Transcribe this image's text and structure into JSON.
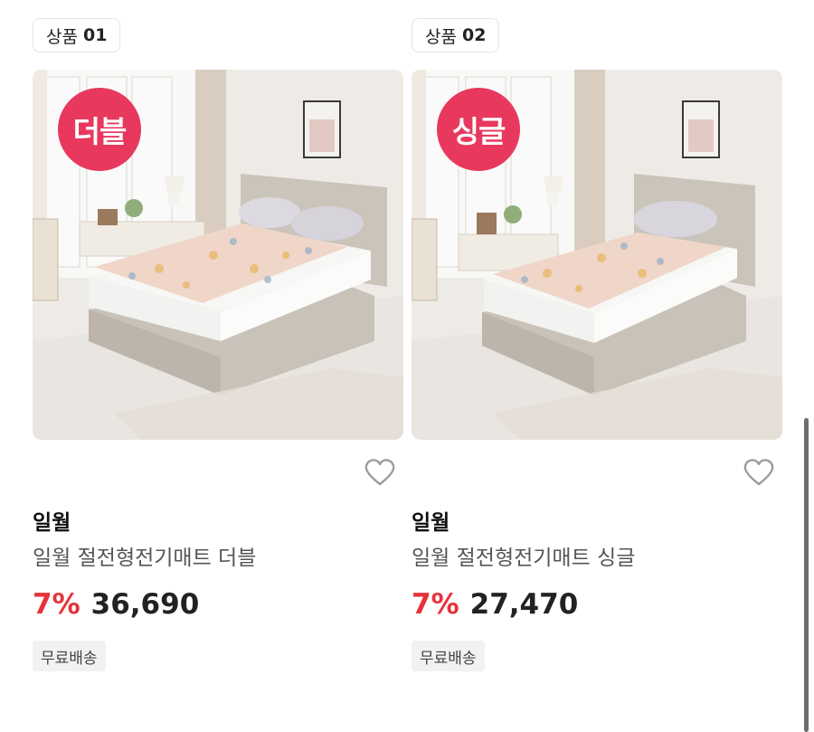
{
  "products": [
    {
      "tag_prefix": "상품",
      "tag_number": "01",
      "badge": "더블",
      "brand": "일월",
      "title": "일월 절전형전기매트 더블",
      "discount": "7%",
      "price": "36,690",
      "shipping": "무료배송",
      "wish_icon": "heart-outline-icon"
    },
    {
      "tag_prefix": "상품",
      "tag_number": "02",
      "badge": "싱글",
      "brand": "일월",
      "title": "일월 절전형전기매트 싱글",
      "discount": "7%",
      "price": "27,470",
      "shipping": "무료배송",
      "wish_icon": "heart-outline-icon"
    }
  ],
  "colors": {
    "badge_bg": "#e8385e",
    "discount": "#e6323b",
    "price": "#222222",
    "shipping_bg": "#f2f2f2"
  }
}
